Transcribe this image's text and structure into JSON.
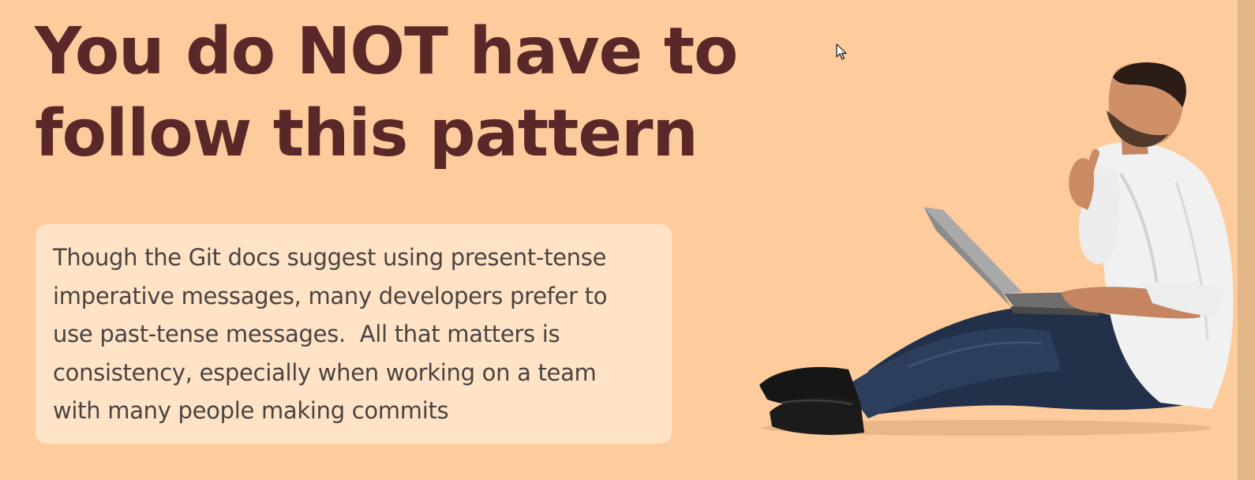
{
  "slide": {
    "title_lines": [
      "You do NOT have to",
      "follow this pattern"
    ],
    "body_lines": [
      "Though the Git docs suggest using present-tense",
      "imperative messages, many developers prefer to",
      "use past-tense messages.  All that matters is",
      "consistency, especially when working on a team",
      "with many people making commits"
    ],
    "illustration_icon": "man-with-laptop-icon",
    "pointer_icon": "mouse-pointer-icon"
  },
  "colors": {
    "background": "#FDCB9C",
    "title": "#5A2828",
    "box": "#FFE3C7",
    "body_text": "#4A4340"
  }
}
